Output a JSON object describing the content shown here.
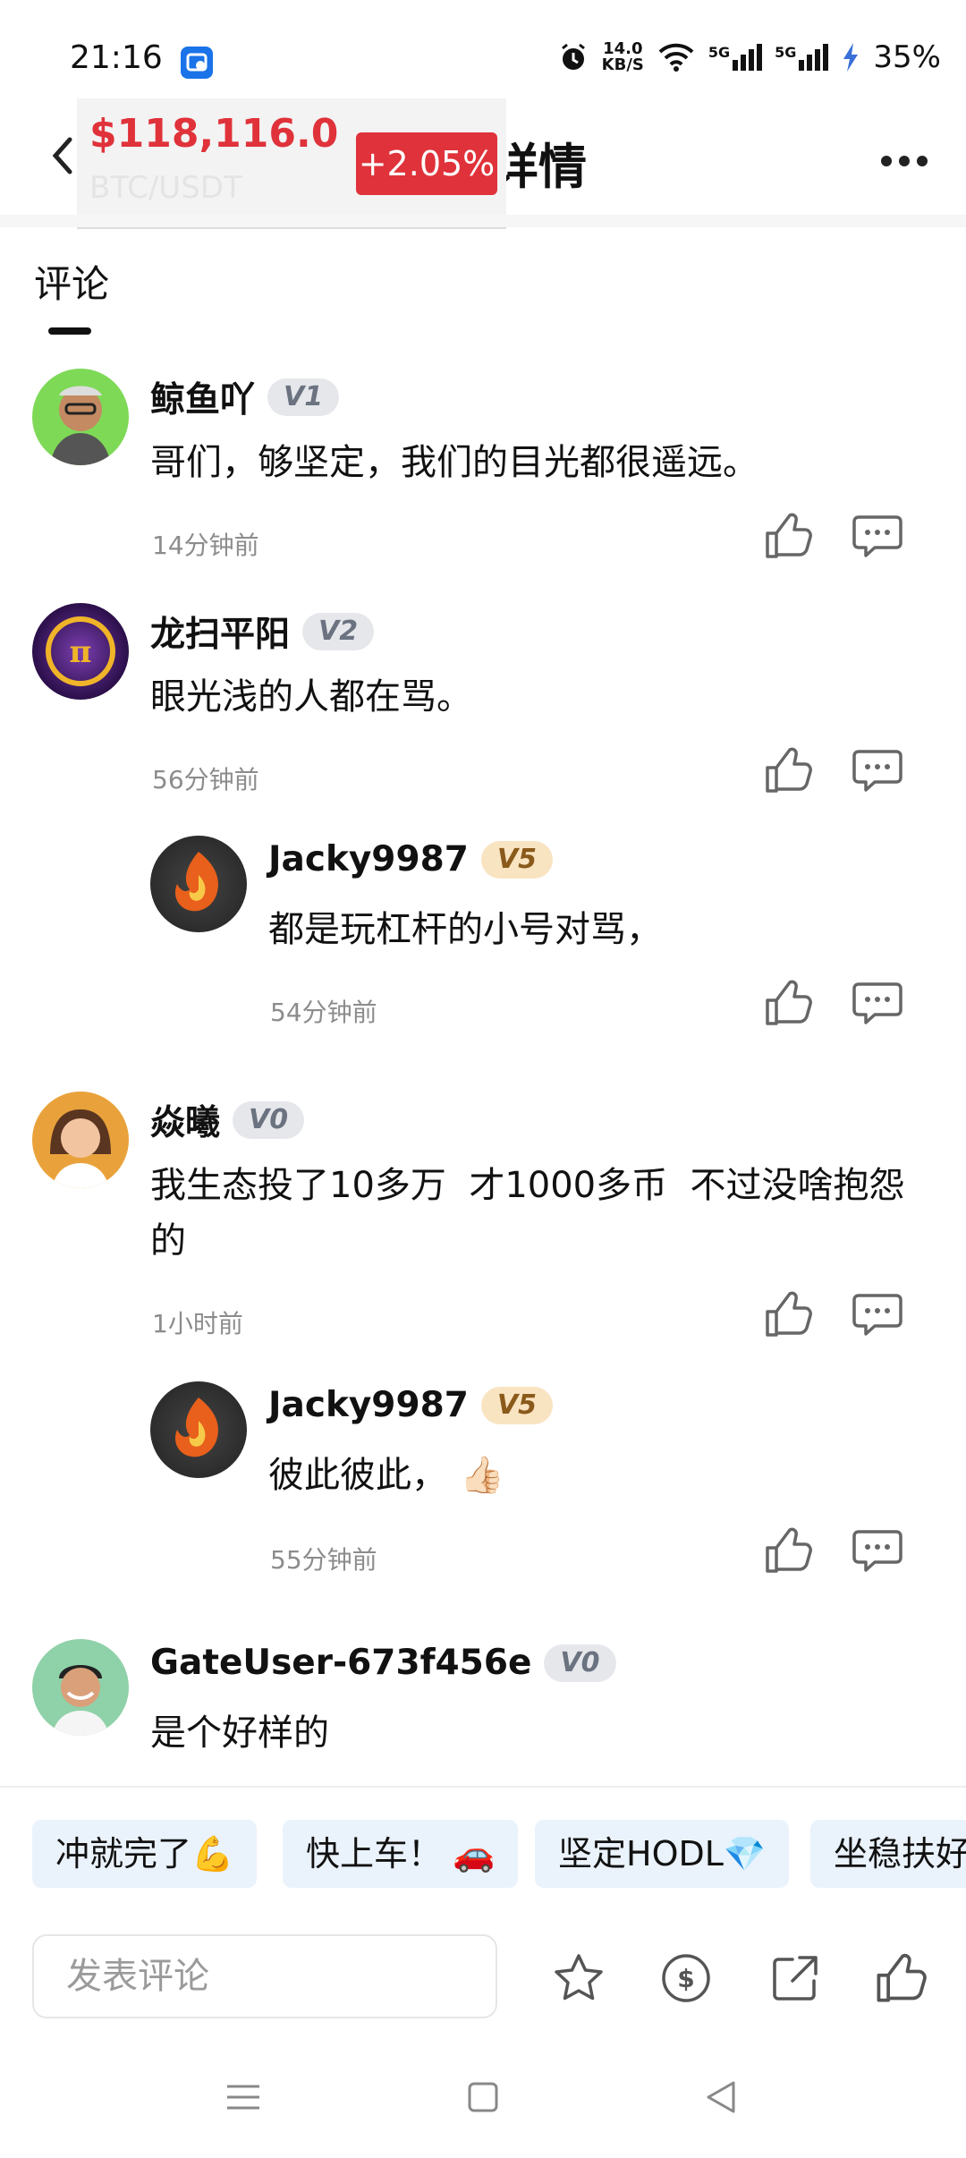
{
  "status_bar": {
    "time": "21:16",
    "net_speed_value": "14.0",
    "net_speed_unit": "KB/S",
    "signal1": "5G",
    "signal2": "5G",
    "battery": "35%"
  },
  "header": {
    "title_visible": "详情",
    "price": "$118,116.0",
    "change": "+2.05%",
    "pair": "BTC/USDT"
  },
  "tabs": {
    "comments": "评论"
  },
  "comments": [
    {
      "user": "鲸鱼吖",
      "level": "V1",
      "text": "哥们，够坚定，我们的目光都很遥远。",
      "time": "14分钟前"
    },
    {
      "user": "龙扫平阳",
      "level": "V2",
      "text": "眼光浅的人都在骂。",
      "time": "56分钟前",
      "reply": {
        "user": "Jacky9987",
        "level": "V5",
        "text": "都是玩杠杆的小号对骂，",
        "time": "54分钟前"
      }
    },
    {
      "user": "焱曦",
      "level": "V0",
      "text_line1": "我生态投了10多万  才1000多币  不过没啥抱怨",
      "text_line2": "的",
      "time": "1小时前",
      "reply": {
        "user": "Jacky9987",
        "level": "V5",
        "text": "彼此彼此，",
        "emoji": "👍🏻",
        "time": "55分钟前"
      }
    },
    {
      "user": "GateUser-673f456e",
      "level": "V0",
      "text": "是个好样的"
    }
  ],
  "quick_replies": [
    "冲就完了💪",
    "快上车！ 🚗",
    "坚定HODL💎",
    "坐稳扶好"
  ],
  "composer": {
    "placeholder": "发表评论"
  },
  "colors": {
    "up_red": "#e0323a",
    "chip_bg": "#eaf2fb"
  }
}
